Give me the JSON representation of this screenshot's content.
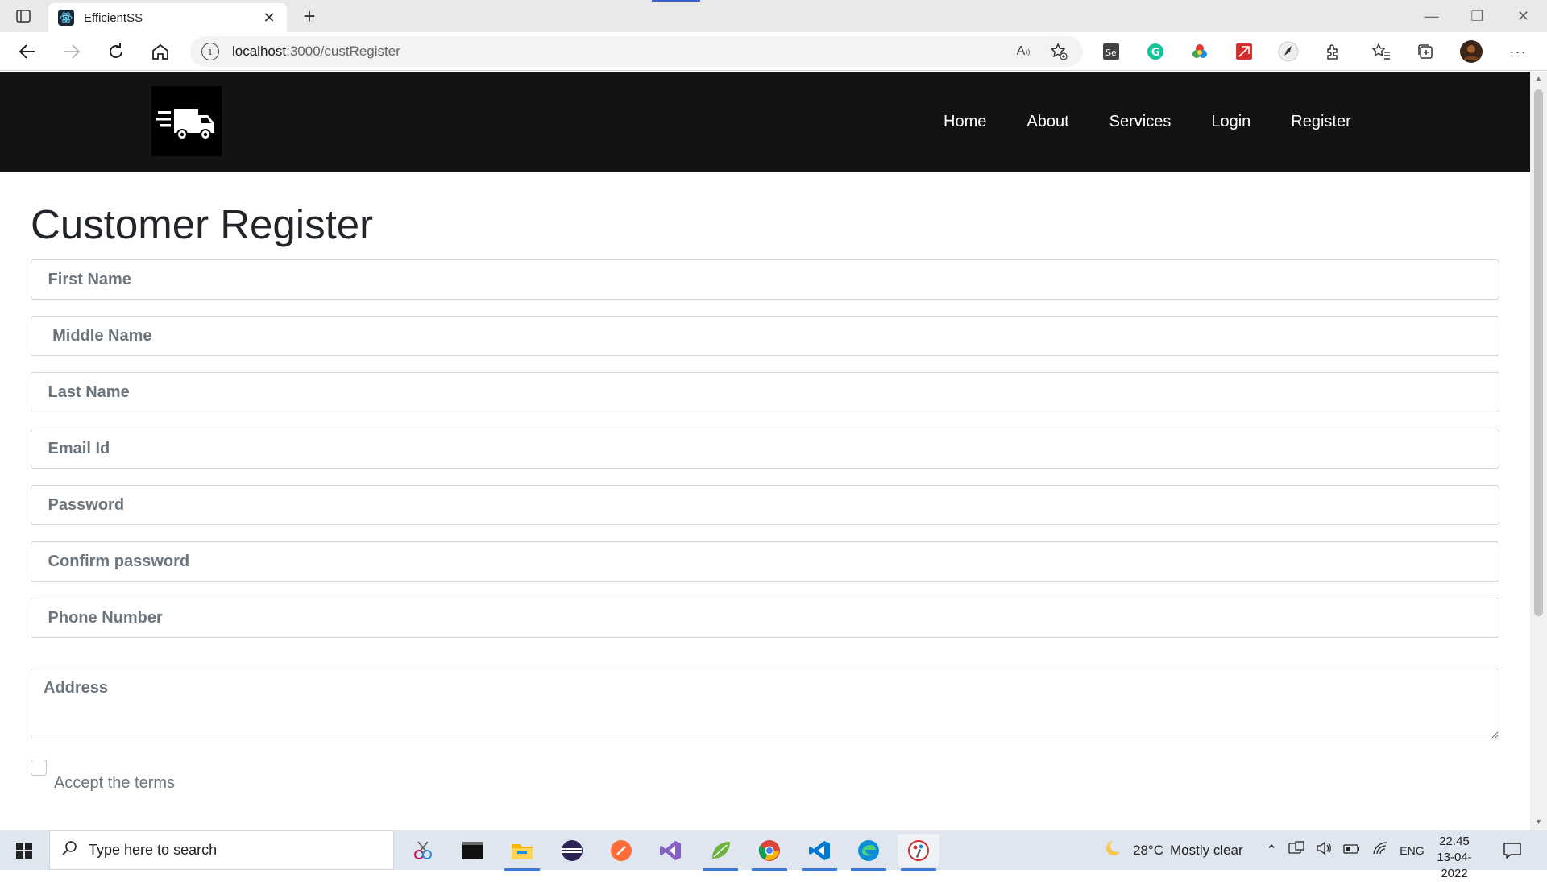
{
  "browser": {
    "tab_title": "EfficientSS",
    "url_host": "localhost",
    "url_rest": ":3000/custRegister",
    "read_aloud": "A̅",
    "new_tab": "+",
    "close_tab": "✕",
    "minimize": "—",
    "restore": "❐",
    "close_window": "✕",
    "more": "···"
  },
  "site": {
    "nav": [
      "Home",
      "About",
      "Services",
      "Login",
      "Register"
    ]
  },
  "form": {
    "title": "Customer Register",
    "fields": {
      "first_name": " First Name",
      "middle_name": "  Middle Name",
      "last_name": " Last Name",
      "email": " Email Id",
      "password": " Password",
      "confirm_password": " Confirm password",
      "phone": " Phone Number",
      "address": "Address"
    },
    "accept_terms": "Accept the terms"
  },
  "taskbar": {
    "search_placeholder": "Type here to search",
    "weather_temp": "28°C",
    "weather_text": "Mostly clear",
    "language": "ENG",
    "time": "22:45",
    "date": "13-04-2022"
  },
  "colors": {
    "header_bg": "#111315",
    "nav_text": "#ffffff",
    "placeholder": "#6c757d"
  }
}
